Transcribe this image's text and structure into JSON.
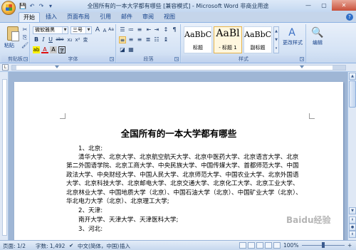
{
  "window": {
    "title": "全国所有的一本大学都有哪些 [兼容模式] - Microsoft Word 非商业用途",
    "minimize": "—",
    "maximize": "▢",
    "close": "✕"
  },
  "qat": {
    "save": "💾",
    "undo": "↶",
    "redo": "↷",
    "more": "▾"
  },
  "tabs": [
    "开始",
    "插入",
    "页面布局",
    "引用",
    "邮件",
    "审阅",
    "视图"
  ],
  "ribbon": {
    "clipboard": {
      "label": "剪贴板",
      "paste": "粘贴",
      "cut": "✂",
      "copy": "⎘",
      "format_painter": "🖌"
    },
    "font": {
      "label": "字体",
      "font_name": "微软雅黑",
      "font_size": "三号",
      "bold": "B",
      "italic": "I",
      "underline": "U",
      "strike": "abe",
      "subscript": "x₂",
      "superscript": "x²",
      "grow": "A",
      "shrink": "A",
      "clear": "Aa",
      "phonetic": "变",
      "border_char": "A",
      "highlight": "ab",
      "font_color": "A",
      "shade": "A",
      "enclose": "字"
    },
    "paragraph": {
      "label": "段落"
    },
    "styles": {
      "label": "样式",
      "items": [
        {
          "sample": "AaBbC",
          "name": "标题"
        },
        {
          "sample": "AaBl",
          "name": "- 标题 1"
        },
        {
          "sample": "AaBbC",
          "name": "副标题"
        }
      ],
      "change_styles": "更改样式"
    },
    "editing": {
      "label": "编辑"
    }
  },
  "document": {
    "title": "全国所有的一本大学都有哪些",
    "paragraphs": [
      {
        "type": "heading",
        "text": "1、北京:"
      },
      {
        "type": "body",
        "text": "清华大学、北京大学、北京航空航天大学、北京中医药大学、北京语言大学、北京第二外国语学院、北京工商大学、中央民族大学、中国传媒大学、首都师范大学、中国政法大学、中央财经大学、中国人民大学、北京师范大学、中国农业大学、北京外国语大学、北京科技大学、北京邮电大学、北京交通大学、北京化工大学、北京工业大学、北京林业大学、中国地质大学（北京）、中国石油大学（北京）、中国矿业大学（北京）、华北电力大学（北京）、北京理工大学;"
      },
      {
        "type": "heading",
        "text": "2、天津:"
      },
      {
        "type": "body",
        "text": "南开大学、天津大学、天津医科大学;"
      },
      {
        "type": "heading",
        "text": "3、河北:"
      }
    ]
  },
  "statusbar": {
    "page": "页面: 1/2",
    "words": "字数: 1,492",
    "language": "中文(简体，中国)",
    "mode": "插入",
    "zoom": "100%"
  },
  "watermark": "Baidu经验"
}
